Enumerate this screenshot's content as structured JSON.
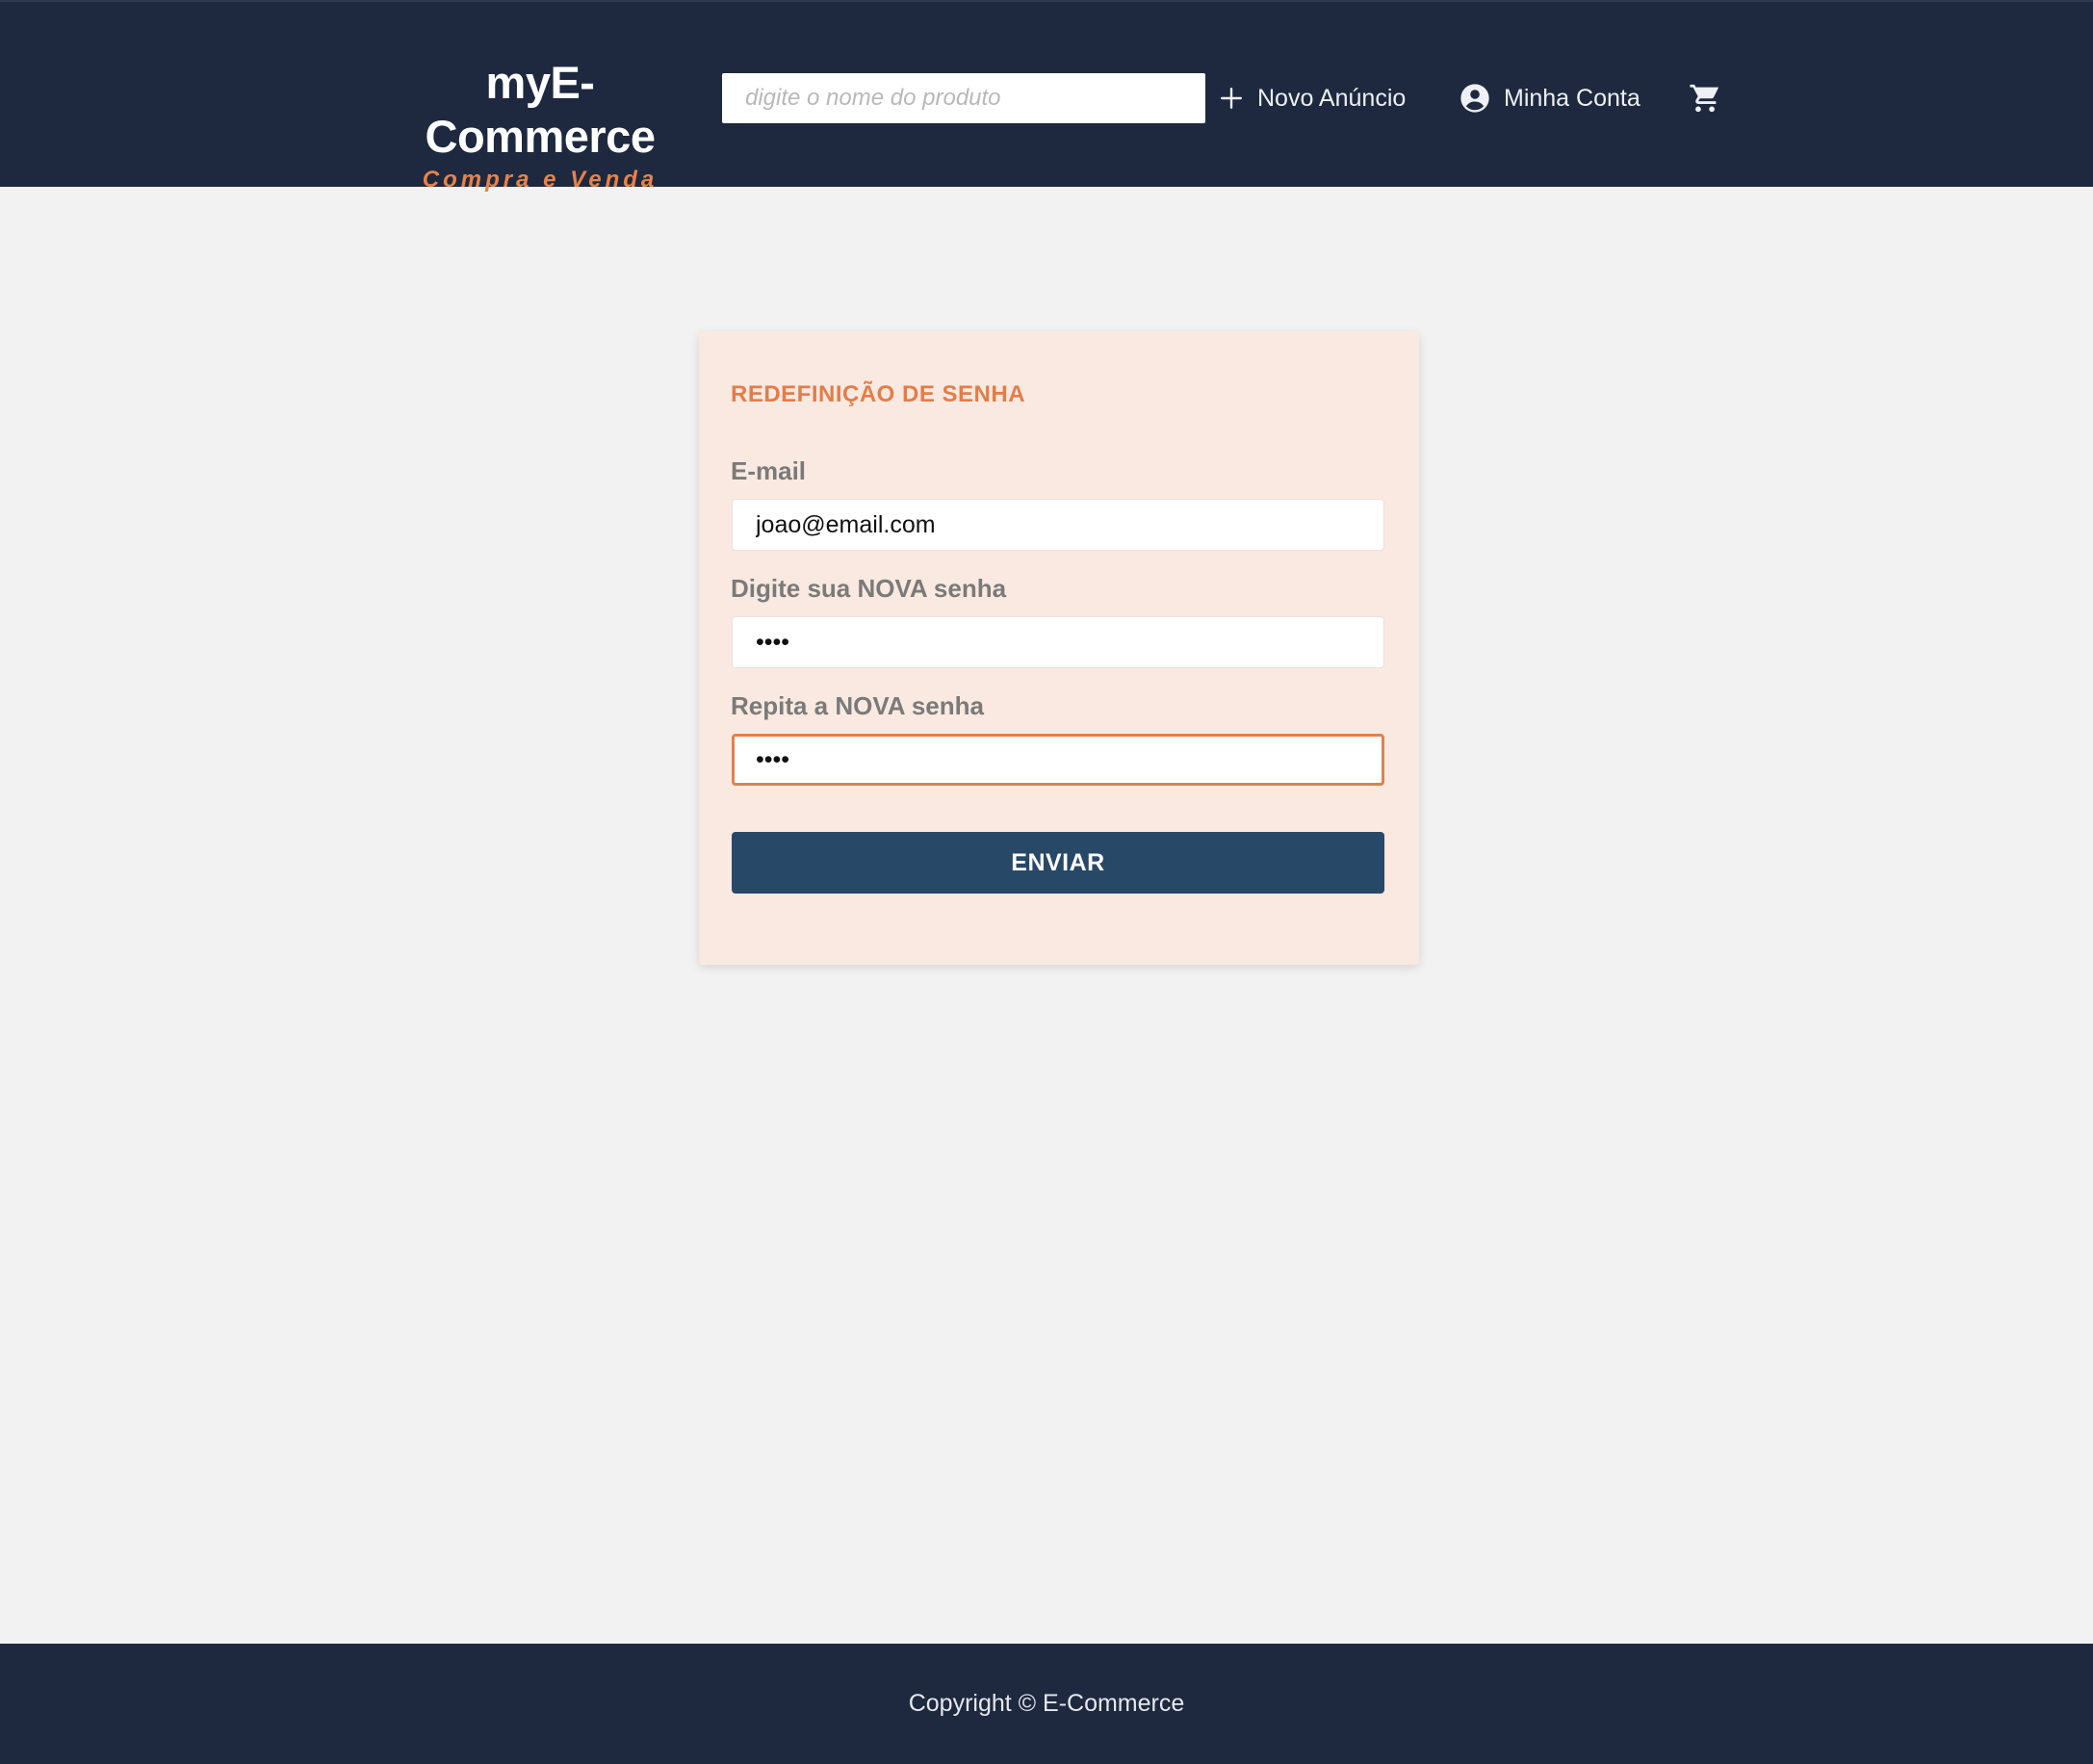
{
  "header": {
    "brand_title": "myE-Commerce",
    "brand_subtitle": "Compra e Venda",
    "search_placeholder": "digite o nome do produto",
    "search_value": "",
    "nav": {
      "new_listing": "Novo Anúncio",
      "account": "Minha Conta"
    },
    "icons": {
      "new_listing": "plus-icon",
      "account": "account-circle-icon",
      "cart": "shopping-cart-icon"
    }
  },
  "form": {
    "title": "REDEFINIÇÃO DE SENHA",
    "email_label": "E-mail",
    "email_value": "joao@email.com",
    "new_password_label": "Digite sua NOVA senha",
    "new_password_value": "••••",
    "repeat_password_label": "Repita a NOVA senha",
    "repeat_password_value": "••••",
    "submit_label": "ENVIAR"
  },
  "footer": {
    "text": "Copyright © E-Commerce"
  },
  "colors": {
    "header_bg": "#1e293f",
    "accent": "#e27d49",
    "button_bg": "#284868",
    "card_bg": "#fae9e0",
    "page_bg": "#f2f2f2"
  }
}
